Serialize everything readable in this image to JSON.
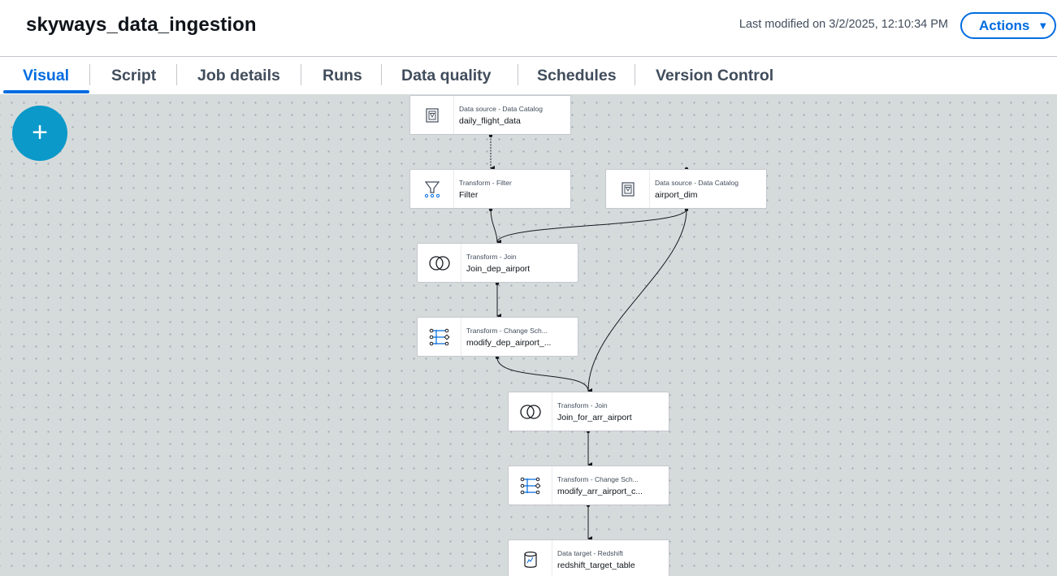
{
  "header": {
    "title": "skyways_data_ingestion",
    "last_modified": "Last modified on 3/2/2025, 12:10:34 PM",
    "actions_label": "Actions"
  },
  "tabs": [
    {
      "label": "Visual",
      "active": true
    },
    {
      "label": "Script"
    },
    {
      "label": "Job details"
    },
    {
      "label": "Runs"
    },
    {
      "label": "Data quality"
    },
    {
      "label": "Schedules"
    },
    {
      "label": "Version Control"
    }
  ],
  "canvas": {
    "add_icon": "plus-icon",
    "nodes": [
      {
        "type": "Data source - Data Catalog",
        "name": "daily_flight_data",
        "icon": "catalog-icon"
      },
      {
        "type": "Transform - Filter",
        "name": "Filter",
        "icon": "filter-icon"
      },
      {
        "type": "Data source - Data Catalog",
        "name": "airport_dim",
        "icon": "catalog-icon"
      },
      {
        "type": "Transform - Join",
        "name": "Join_dep_airport",
        "icon": "join-icon"
      },
      {
        "type": "Transform - Change Sch...",
        "name": "modify_dep_airport_...",
        "icon": "schema-icon"
      },
      {
        "type": "Transform - Join",
        "name": "Join_for_arr_airport",
        "icon": "join-icon"
      },
      {
        "type": "Transform - Change Sch...",
        "name": "modify_arr_airport_c...",
        "icon": "schema-icon"
      },
      {
        "type": "Data target - Redshift",
        "name": "redshift_target_table",
        "icon": "redshift-icon"
      }
    ]
  },
  "colors": {
    "accent": "#006ce0",
    "add_button": "#0a99c9",
    "canvas_bg": "#d5dbdb"
  }
}
